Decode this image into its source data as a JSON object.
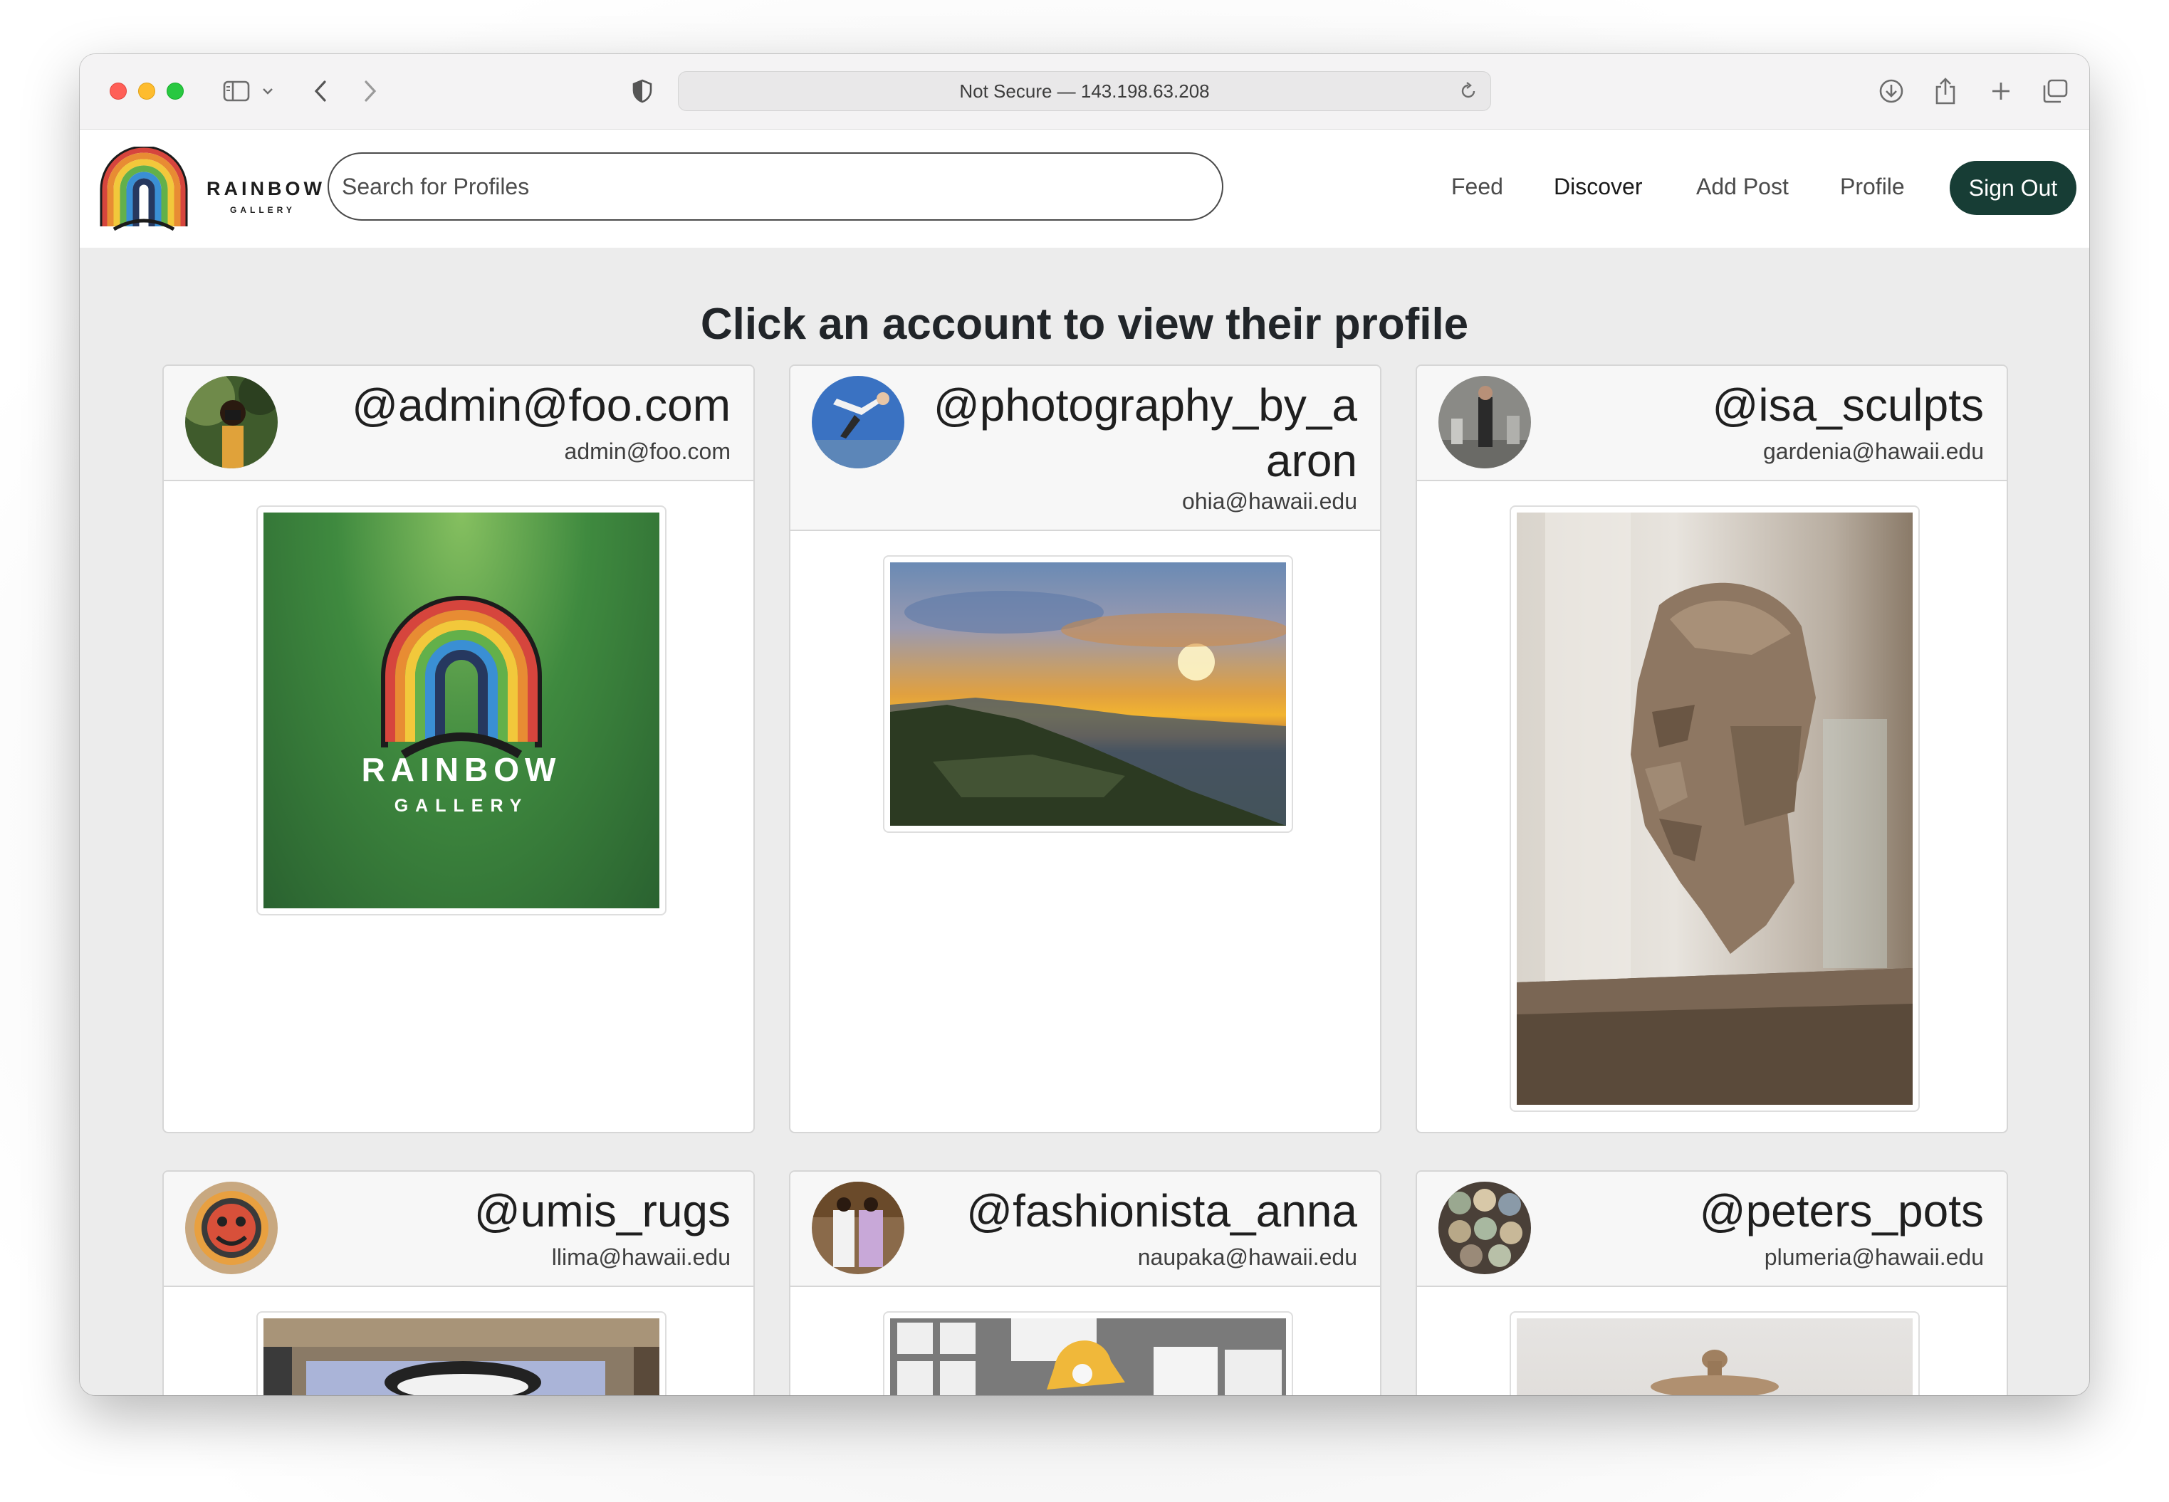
{
  "browser": {
    "url_text": "Not Secure — 143.198.63.208"
  },
  "navbar": {
    "logo_title": "RAINBOW",
    "logo_subtitle": "GALLERY",
    "search_placeholder": "Search for Profiles",
    "links": [
      "Feed",
      "Discover",
      "Add Post",
      "Profile"
    ],
    "active_link": "Discover",
    "sign_out": "Sign Out"
  },
  "page": {
    "heading": "Click an account to view their profile"
  },
  "profiles": [
    {
      "handle": "@admin@foo.com",
      "email": "admin@foo.com",
      "post_image": "rainbow-gallery-logo",
      "post_text_1": "RAINBOW",
      "post_text_2": "GALLERY"
    },
    {
      "handle": "@photography_by_aaron",
      "email": "ohia@hawaii.edu",
      "post_image": "sunset-coastline"
    },
    {
      "handle": "@isa_sculpts",
      "email": "gardenia@hawaii.edu",
      "post_image": "cardboard-head-sculpture"
    },
    {
      "handle": "@umis_rugs",
      "email": "llima@hawaii.edu",
      "post_image": "rug"
    },
    {
      "handle": "@fashionista_anna",
      "email": "naupaka@hawaii.edu",
      "post_image": "fashion-sketches"
    },
    {
      "handle": "@peters_pots",
      "email": "plumeria@hawaii.edu",
      "post_image": "ceramic-pot"
    }
  ],
  "colors": {
    "sign_out_bg": "#173d35",
    "page_bg": "#ececec",
    "logo_green": "#2e6b34"
  }
}
